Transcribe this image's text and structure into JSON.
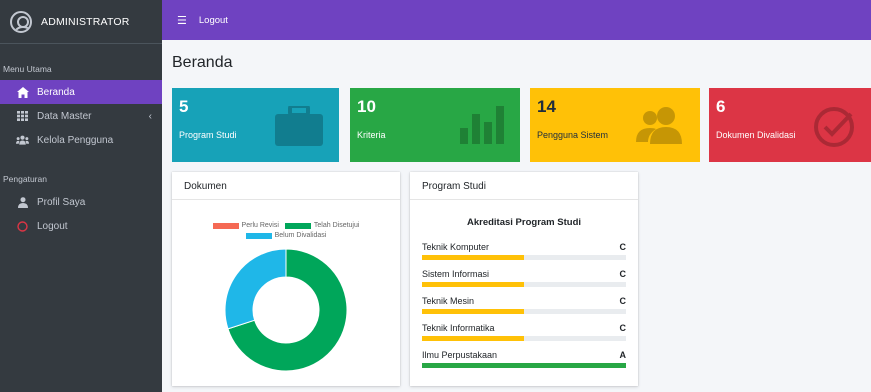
{
  "sidebar": {
    "brand": "ADMINISTRATOR",
    "section_main": "Menu Utama",
    "section_settings": "Pengaturan",
    "items": [
      {
        "label": "Beranda",
        "icon": "home-icon",
        "active": true
      },
      {
        "label": "Data Master",
        "icon": "grid-icon"
      },
      {
        "label": "Kelola Pengguna",
        "icon": "users-icon"
      },
      {
        "label": "Profil Saya",
        "icon": "user-icon"
      },
      {
        "label": "Logout",
        "icon": "circle-icon"
      }
    ]
  },
  "topbar": {
    "logout_label": "Logout"
  },
  "page": {
    "title": "Beranda"
  },
  "stats": [
    {
      "value": "5",
      "label": "Program Studi",
      "color": "#17a2b8",
      "icon": "briefcase-icon"
    },
    {
      "value": "10",
      "label": "Kriteria",
      "color": "#28a745",
      "icon": "bar-chart-icon"
    },
    {
      "value": "14",
      "label": "Pengguna Sistem",
      "color": "#ffc107",
      "icon": "users-icon"
    },
    {
      "value": "6",
      "label": "Dokumen Divalidasi",
      "color": "#dc3545",
      "icon": "check-circle-icon"
    }
  ],
  "dokumen": {
    "title": "Dokumen",
    "legend": [
      {
        "label": "Perlu Revisi",
        "color": "#f56954"
      },
      {
        "label": "Telah Disetujui",
        "color": "#00a65a"
      },
      {
        "label": "Belum Divalidasi",
        "color": "#1fb7e8"
      }
    ]
  },
  "chart_data": {
    "type": "pie",
    "categories": [
      "Perlu Revisi",
      "Telah Disetujui",
      "Belum Divalidasi"
    ],
    "values": [
      0,
      70,
      30
    ],
    "colors": [
      "#f56954",
      "#00a65a",
      "#1fb7e8"
    ],
    "legend": "top"
  },
  "program_studi": {
    "card_title": "Program Studi",
    "chart_title": "Akreditasi Program Studi",
    "items": [
      {
        "name": "Teknik Komputer",
        "grade": "C",
        "progress": 0.5,
        "color": "#ffc107"
      },
      {
        "name": "Sistem Informasi",
        "grade": "C",
        "progress": 0.5,
        "color": "#ffc107"
      },
      {
        "name": "Teknik Mesin",
        "grade": "C",
        "progress": 0.5,
        "color": "#ffc107"
      },
      {
        "name": "Teknik Informatika",
        "grade": "C",
        "progress": 0.5,
        "color": "#ffc107"
      },
      {
        "name": "Ilmu Perpustakaan",
        "grade": "A",
        "progress": 1.0,
        "color": "#28a745"
      }
    ]
  }
}
